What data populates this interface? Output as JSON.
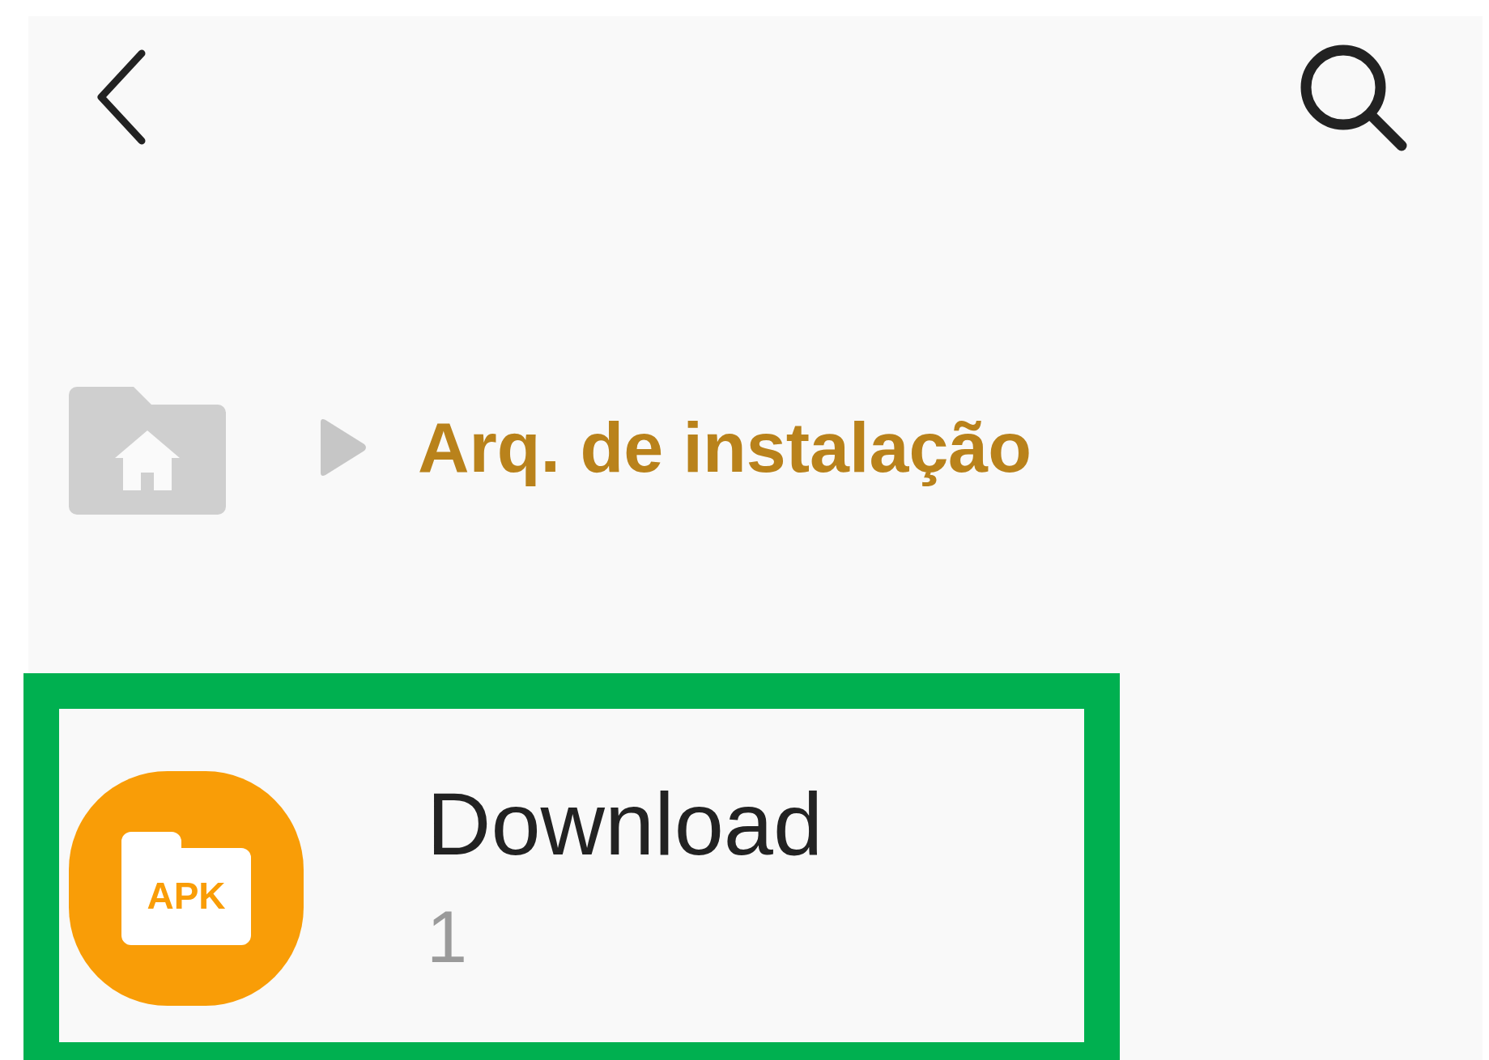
{
  "breadcrumb": {
    "current": "Arq. de instalação"
  },
  "items": [
    {
      "name": "Download",
      "count": "1",
      "icon_label": "APK",
      "highlighted": true
    }
  ]
}
